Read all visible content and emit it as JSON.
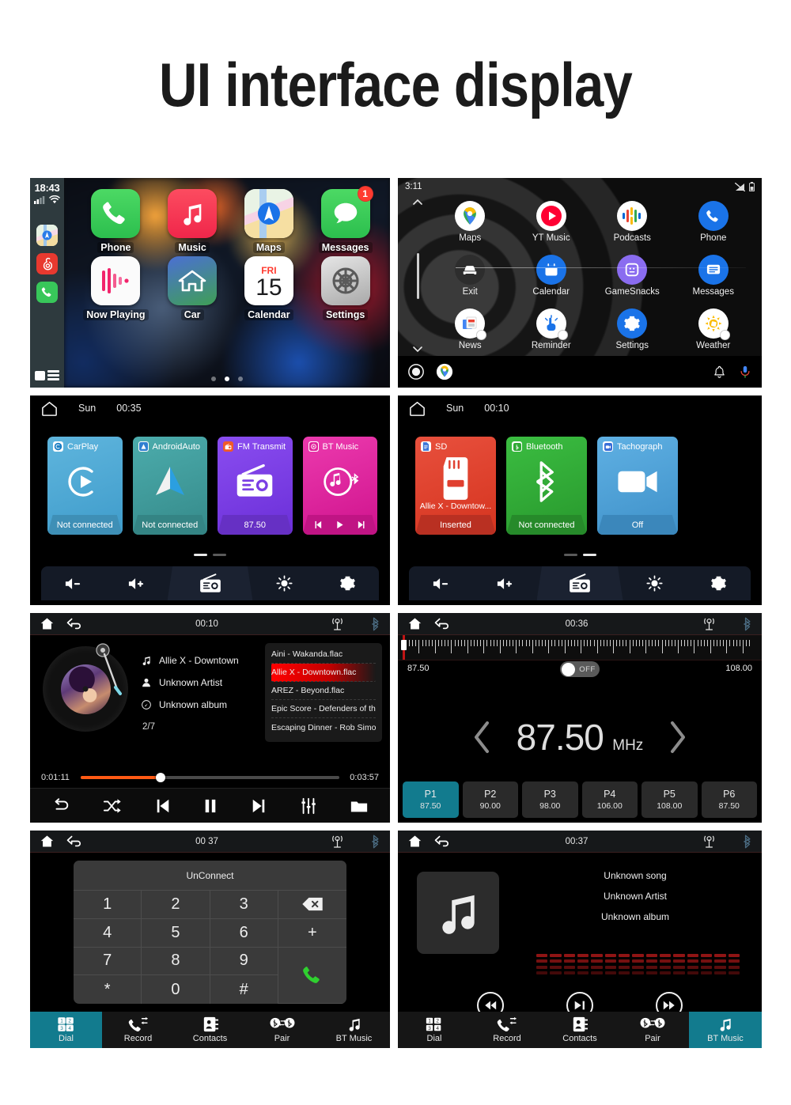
{
  "page": {
    "title": "UI interface display"
  },
  "carplay": {
    "status": {
      "time": "18:43",
      "signal_icon": "cellular-signal-icon",
      "wifi_icon": "wifi-icon"
    },
    "sidebar_apps": [
      {
        "name": "maps-mini-icon"
      },
      {
        "name": "netease-music-mini-icon"
      },
      {
        "name": "phone-mini-icon"
      }
    ],
    "list_button": "app-list-icon",
    "apps": [
      {
        "label": "Phone",
        "icon": "phone-icon",
        "badge": ""
      },
      {
        "label": "Music",
        "icon": "music-icon",
        "badge": ""
      },
      {
        "label": "Maps",
        "icon": "maps-icon",
        "badge": ""
      },
      {
        "label": "Messages",
        "icon": "messages-icon",
        "badge": "1"
      },
      {
        "label": "Now Playing",
        "icon": "now-playing-icon",
        "badge": ""
      },
      {
        "label": "Car",
        "icon": "car-home-icon",
        "badge": ""
      },
      {
        "label": "Calendar",
        "icon": "calendar-icon",
        "badge": ""
      },
      {
        "label": "Settings",
        "icon": "settings-icon",
        "badge": ""
      }
    ],
    "calendar": {
      "weekday": "FRI",
      "day": "15"
    },
    "page_dots": {
      "count": 3,
      "active_index": 1
    }
  },
  "androidauto": {
    "status": {
      "time": "3:11",
      "signal_icon": "signal-off-icon",
      "battery_icon": "battery-icon"
    },
    "apps": [
      {
        "label": "Maps",
        "icon": "google-maps-icon"
      },
      {
        "label": "YT Music",
        "icon": "youtube-music-icon"
      },
      {
        "label": "Podcasts",
        "icon": "google-podcasts-icon"
      },
      {
        "label": "Phone",
        "icon": "phone-icon"
      },
      {
        "label": "Exit",
        "icon": "car-exit-icon"
      },
      {
        "label": "Calendar",
        "icon": "calendar-icon"
      },
      {
        "label": "GameSnacks",
        "icon": "gamesnacks-icon"
      },
      {
        "label": "Messages",
        "icon": "messages-icon"
      },
      {
        "label": "News",
        "icon": "google-news-icon"
      },
      {
        "label": "Reminder",
        "icon": "reminder-icon"
      },
      {
        "label": "Settings",
        "icon": "settings-gear-icon"
      },
      {
        "label": "Weather",
        "icon": "weather-icon"
      }
    ],
    "nav": {
      "home_icon": "circle-home-icon",
      "maps_icon": "google-maps-icon",
      "bell_icon": "notification-bell-icon",
      "mic_icon": "microphone-icon"
    }
  },
  "home1": {
    "home_icon": "home-icon",
    "day": "Sun",
    "time": "00:35",
    "tiles": [
      {
        "name": "CarPlay",
        "badge_icon": "carplay-badge-icon",
        "art_icon": "carplay-logo-icon",
        "subtitle": "",
        "footer": "Not connected",
        "color": "#4CA8D4",
        "footer_color": "#3E8FB6"
      },
      {
        "name": "AndroidAuto",
        "badge_icon": "androidauto-badge-icon",
        "art_icon": "androidauto-logo-icon",
        "subtitle": "",
        "footer": "Not connected",
        "color": "#409E9E",
        "footer_color": "#348484"
      },
      {
        "name": "FM Transmit",
        "badge_icon": "fm-badge-icon",
        "art_icon": "radio-icon",
        "subtitle": "",
        "footer": "87.50",
        "color": "#7B3FE4",
        "footer_color": "#6630C4"
      },
      {
        "name": "BT Music",
        "badge_icon": "bt-music-badge-icon",
        "art_icon": "bt-music-logo-icon",
        "subtitle": "",
        "footer": "",
        "color": "#E0219B",
        "footer_color": "#C01484"
      }
    ],
    "page_dots": {
      "count": 2,
      "active_index": 0
    },
    "toolbar": [
      {
        "icon": "volume-down-icon"
      },
      {
        "icon": "volume-up-icon"
      },
      {
        "icon": "radio-icon"
      },
      {
        "icon": "brightness-icon"
      },
      {
        "icon": "settings-gear-icon"
      }
    ]
  },
  "home2": {
    "home_icon": "home-icon",
    "day": "Sun",
    "time": "00:10",
    "tiles": [
      {
        "name": "SD",
        "badge_icon": "sd-badge-icon",
        "art_icon": "sd-card-icon",
        "subtitle": "Allie X - Downtow...",
        "footer": "Inserted",
        "color": "#E04030",
        "footer_color": "#B93022"
      },
      {
        "name": "Bluetooth",
        "badge_icon": "bluetooth-badge-icon",
        "art_icon": "bluetooth-icon",
        "subtitle": "",
        "footer": "Not connected",
        "color": "#31A936",
        "footer_color": "#268A2A"
      },
      {
        "name": "Tachograph",
        "badge_icon": "camera-badge-icon",
        "art_icon": "camcorder-icon",
        "subtitle": "",
        "footer": "Off",
        "color": "#4DA3DB",
        "footer_color": "#3B87BB"
      }
    ],
    "page_dots": {
      "count": 2,
      "active_index": 1
    },
    "toolbar": [
      {
        "icon": "volume-down-icon"
      },
      {
        "icon": "volume-up-icon"
      },
      {
        "icon": "radio-icon"
      },
      {
        "icon": "brightness-icon"
      },
      {
        "icon": "settings-gear-icon"
      }
    ]
  },
  "player": {
    "topbar": {
      "home_icon": "home-icon",
      "back_icon": "back-icon",
      "time": "00:10",
      "radio_icon": "antenna-icon",
      "bt_icon": "bluetooth-icon"
    },
    "track": {
      "title": "Allie X - Downtown",
      "artist": "Unknown Artist",
      "album": "Unknown album",
      "index": "2/7"
    },
    "playlist": [
      {
        "label": "Aini - Wakanda.flac",
        "selected": false
      },
      {
        "label": "Allie X - Downtown.flac",
        "selected": true
      },
      {
        "label": "AREZ - Beyond.flac",
        "selected": false
      },
      {
        "label": "Epic Score - Defenders of the Sk..",
        "selected": false
      },
      {
        "label": "Escaping Dinner - Rob Simonse...",
        "selected": false
      }
    ],
    "progress": {
      "elapsed": "0:01:11",
      "total": "0:03:57",
      "percent": 31
    },
    "controls": [
      {
        "icon": "repeat-icon"
      },
      {
        "icon": "shuffle-icon"
      },
      {
        "icon": "previous-icon"
      },
      {
        "icon": "pause-icon"
      },
      {
        "icon": "next-icon"
      },
      {
        "icon": "equalizer-icon"
      },
      {
        "icon": "folder-icon"
      }
    ]
  },
  "radio": {
    "topbar": {
      "home_icon": "home-icon",
      "back_icon": "back-icon",
      "time": "00:36",
      "radio_icon": "antenna-icon",
      "bt_icon": "bluetooth-icon"
    },
    "band_min": "87.50",
    "band_max": "108.00",
    "toggle_label": "OFF",
    "toggle_on": false,
    "frequency": "87.50",
    "unit": "MHz",
    "prev_icon": "chevron-left-icon",
    "next_icon": "chevron-right-icon",
    "presets": [
      {
        "name": "P1",
        "freq": "87.50",
        "active": true
      },
      {
        "name": "P2",
        "freq": "90.00",
        "active": false
      },
      {
        "name": "P3",
        "freq": "98.00",
        "active": false
      },
      {
        "name": "P4",
        "freq": "106.00",
        "active": false
      },
      {
        "name": "P5",
        "freq": "108.00",
        "active": false
      },
      {
        "name": "P6",
        "freq": "87.50",
        "active": false
      }
    ]
  },
  "dialer": {
    "topbar": {
      "home_icon": "home-icon",
      "back_icon": "back-icon",
      "time": "00 37",
      "radio_icon": "antenna-icon",
      "bt_icon": "bluetooth-icon"
    },
    "status": "UnConnect",
    "keys": [
      "1",
      "2",
      "3",
      "4",
      "5",
      "6",
      "7",
      "8",
      "9",
      "*",
      "0",
      "#"
    ],
    "backspace_icon": "backspace-icon",
    "plus_key": "+",
    "call_icon": "call-icon",
    "tabs": [
      {
        "label": "Dial",
        "icon": "keypad-icon",
        "active": true
      },
      {
        "label": "Record",
        "icon": "call-log-icon",
        "active": false
      },
      {
        "label": "Contacts",
        "icon": "contacts-icon",
        "active": false
      },
      {
        "label": "Pair",
        "icon": "bt-pair-icon",
        "active": false
      },
      {
        "label": "BT Music",
        "icon": "music-note-icon",
        "active": false
      }
    ]
  },
  "btmusic": {
    "topbar": {
      "home_icon": "home-icon",
      "back_icon": "back-icon",
      "time": "00:37",
      "radio_icon": "antenna-icon",
      "bt_icon": "bluetooth-icon"
    },
    "cover_icon": "music-note-icon",
    "song": "Unknown song",
    "artist": "Unknown Artist",
    "album": "Unknown album",
    "eq_color": "#8f1414",
    "eq_columns": 15,
    "controls": [
      {
        "icon": "previous-track-icon"
      },
      {
        "icon": "play-pause-icon"
      },
      {
        "icon": "next-track-icon"
      }
    ],
    "tabs": [
      {
        "label": "Dial",
        "icon": "keypad-icon",
        "active": false
      },
      {
        "label": "Record",
        "icon": "call-log-icon",
        "active": false
      },
      {
        "label": "Contacts",
        "icon": "contacts-icon",
        "active": false
      },
      {
        "label": "Pair",
        "icon": "bt-pair-icon",
        "active": false
      },
      {
        "label": "BT Music",
        "icon": "music-note-icon",
        "active": true
      }
    ]
  }
}
